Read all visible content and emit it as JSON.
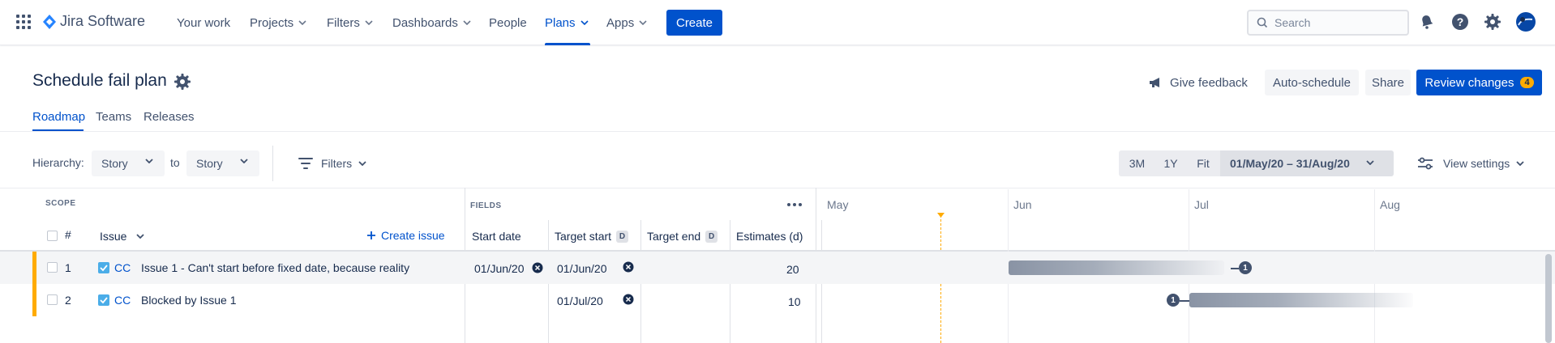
{
  "topnav": {
    "logo_text": "Jira Software",
    "items": [
      {
        "label": "Your work"
      },
      {
        "label": "Projects"
      },
      {
        "label": "Filters"
      },
      {
        "label": "Dashboards"
      },
      {
        "label": "People"
      },
      {
        "label": "Plans"
      },
      {
        "label": "Apps"
      }
    ],
    "active_item": "Plans",
    "create_label": "Create",
    "search_placeholder": "Search"
  },
  "header": {
    "title": "Schedule fail plan",
    "feedback_label": "Give feedback",
    "autoschedule_label": "Auto-schedule",
    "share_label": "Share",
    "review_label": "Review changes",
    "review_count": "4"
  },
  "tabs": [
    {
      "label": "Roadmap"
    },
    {
      "label": "Teams"
    },
    {
      "label": "Releases"
    }
  ],
  "toolbar": {
    "hierarchy_label": "Hierarchy:",
    "hierarchy_from": "Story",
    "to_label": "to",
    "hierarchy_to": "Story",
    "filters_label": "Filters",
    "range_3m": "3M",
    "range_1y": "1Y",
    "range_fit": "Fit",
    "date_range": "01/May/20 – 31/Aug/20",
    "view_settings_label": "View settings"
  },
  "table": {
    "scope_label": "SCOPE",
    "fields_label": "FIELDS",
    "col_hash": "#",
    "col_issue": "Issue",
    "create_issue_label": "Create issue",
    "col_start_date": "Start date",
    "col_target_start": "Target start",
    "col_target_end": "Target end",
    "col_estimates": "Estimates (d)",
    "d_badge": "D",
    "rows": [
      {
        "num": "1",
        "key": "CC",
        "summary": "Issue 1 - Can't start before fixed date, because reality",
        "start_date": "01/Jun/20",
        "target_start": "01/Jun/20",
        "target_end": "",
        "estimate": "20"
      },
      {
        "num": "2",
        "key": "CC",
        "summary": "Blocked by Issue 1",
        "start_date": "",
        "target_start": "01/Jul/20",
        "target_end": "",
        "estimate": "10"
      }
    ]
  },
  "timeline": {
    "months": [
      "May",
      "Jun",
      "Jul",
      "Aug"
    ],
    "dependency_count_1": "1",
    "dependency_count_2": "1"
  },
  "colors": {
    "accent": "#0052cc",
    "badge": "#ffab00",
    "row_marker": "#ffab00",
    "bar": "#7a869a"
  }
}
